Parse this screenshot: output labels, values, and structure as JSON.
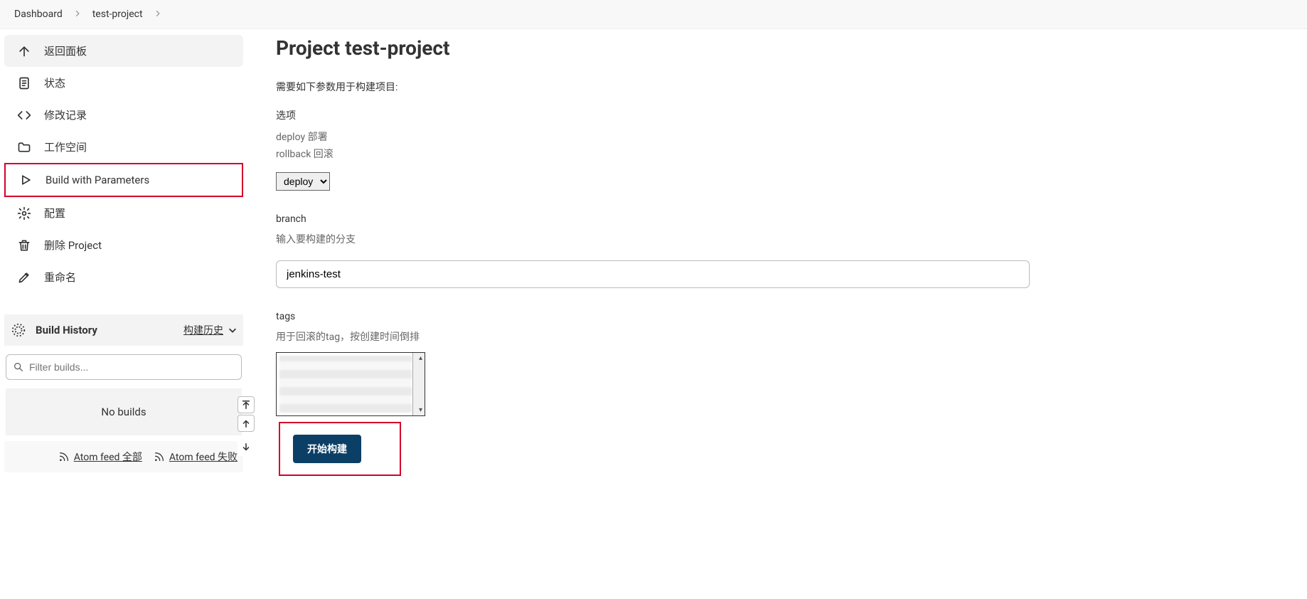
{
  "breadcrumb": {
    "items": [
      "Dashboard",
      "test-project"
    ]
  },
  "sidebar": {
    "items": [
      {
        "label": "返回面板",
        "icon": "arrow-up-icon"
      },
      {
        "label": "状态",
        "icon": "document-icon"
      },
      {
        "label": "修改记录",
        "icon": "code-icon"
      },
      {
        "label": "工作空间",
        "icon": "folder-icon"
      },
      {
        "label": "Build with Parameters",
        "icon": "play-icon"
      },
      {
        "label": "配置",
        "icon": "gear-icon"
      },
      {
        "label": "删除 Project",
        "icon": "trash-icon"
      },
      {
        "label": "重命名",
        "icon": "pencil-icon"
      }
    ]
  },
  "build_history": {
    "title": "Build History",
    "toggle_label": "构建历史",
    "filter_placeholder": "Filter builds...",
    "empty": "No builds",
    "feeds": {
      "all": "Atom feed 全部",
      "fail": "Atom feed 失败"
    }
  },
  "page": {
    "title": "Project test-project",
    "description": "需要如下参数用于构建项目:"
  },
  "params": {
    "option": {
      "label": "选项",
      "option1": "deploy 部署",
      "option2": "rollback 回滚",
      "select_value": "deploy",
      "select_option": "deploy"
    },
    "branch": {
      "label": "branch",
      "help": "输入要构建的分支",
      "value": "jenkins-test"
    },
    "tags": {
      "label": "tags",
      "help": "用于回滚的tag，按创建时间倒排"
    }
  },
  "actions": {
    "build": "开始构建"
  }
}
